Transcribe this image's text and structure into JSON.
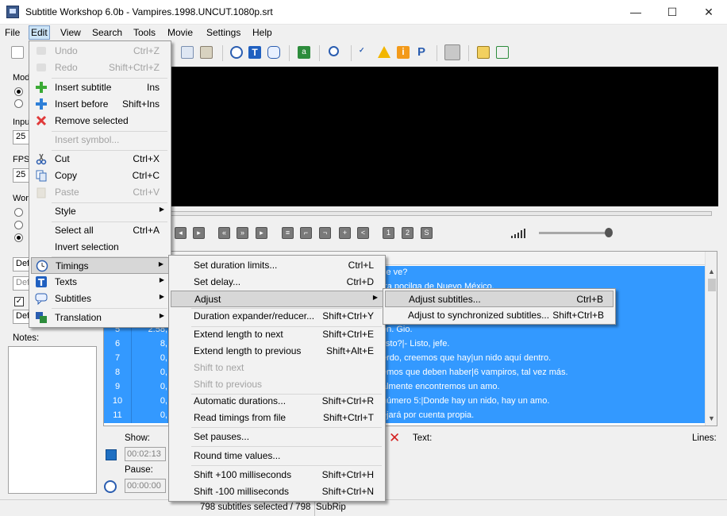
{
  "window": {
    "title": "Subtitle Workshop 6.0b - Vampires.1998.UNCUT.1080p.srt",
    "minimize": "—",
    "maximize": "☐",
    "close": "✕"
  },
  "menubar": [
    "File",
    "Edit",
    "View",
    "Search",
    "Tools",
    "Movie",
    "Settings",
    "Help"
  ],
  "left_panel": {
    "mode_label": "Mod",
    "input_label": "Inpu",
    "input_value": "25",
    "fps_label": "FPS",
    "fps_value": "25",
    "work_label": "Wor",
    "combo1": "Def",
    "combo2": "Def",
    "combo3": "Def",
    "notes_label": "Notes:"
  },
  "subtitle_rows": [
    {
      "num": "",
      "time": "",
      "text": "se ve?"
    },
    {
      "num": "",
      "time": "",
      "text": "tra pocilga de Nuevo México."
    },
    {
      "num": "",
      "time": "",
      "text": ""
    },
    {
      "num": "",
      "time": "",
      "text": ""
    },
    {
      "num": "5",
      "time": "2:58,",
      "text": "en. Gio."
    },
    {
      "num": "6",
      "time": "8,",
      "text": "listo?|- Listo, jefe."
    },
    {
      "num": "7",
      "time": "0,",
      "text": "erdo, creemos que hay|un nido aquí dentro."
    },
    {
      "num": "8",
      "time": "0,",
      "text": "emos que deben haber|6 vampiros, tal vez más."
    },
    {
      "num": "9",
      "time": "0,",
      "text": "almente encontremos un amo."
    },
    {
      "num": "10",
      "time": "0,",
      "text": "número 5:|Donde hay un nido, hay un amo."
    },
    {
      "num": "11",
      "time": "0,",
      "text": "ejará por cuenta propia."
    }
  ],
  "editor": {
    "show_label": "Show:",
    "show_value": "00:02:13",
    "pause_label": "Pause:",
    "pause_value": "00:00:00",
    "text_label": "Text:",
    "lines_label": "Lines:"
  },
  "status": "798 subtitles selected / 798",
  "status_format": "SubRip",
  "edit_menu": [
    {
      "label": "Undo",
      "shortcut": "Ctrl+Z",
      "disabled": true,
      "icon": "undo-icon"
    },
    {
      "label": "Redo",
      "shortcut": "Shift+Ctrl+Z",
      "disabled": true,
      "icon": "redo-icon"
    },
    {
      "label": "Insert subtitle",
      "shortcut": "Ins",
      "disabled": false,
      "icon": "plus-icon"
    },
    {
      "label": "Insert before",
      "shortcut": "Shift+Ins",
      "disabled": false,
      "icon": "plus-blue-icon"
    },
    {
      "label": "Remove selected",
      "shortcut": "",
      "disabled": false,
      "icon": "remove-icon"
    },
    {
      "label": "Insert symbol...",
      "shortcut": "",
      "disabled": true,
      "icon": ""
    },
    {
      "label": "Cut",
      "shortcut": "Ctrl+X",
      "disabled": false,
      "icon": "scissors-icon"
    },
    {
      "label": "Copy",
      "shortcut": "Ctrl+C",
      "disabled": false,
      "icon": "copy-icon"
    },
    {
      "label": "Paste",
      "shortcut": "Ctrl+V",
      "disabled": true,
      "icon": "paste-icon"
    },
    {
      "label": "Style",
      "shortcut": "",
      "disabled": false,
      "icon": ""
    },
    {
      "label": "Select all",
      "shortcut": "Ctrl+A",
      "disabled": false,
      "icon": ""
    },
    {
      "label": "Invert selection",
      "shortcut": "",
      "disabled": false,
      "icon": ""
    },
    {
      "label": "Timings",
      "shortcut": "",
      "disabled": false,
      "icon": "clock-icon"
    },
    {
      "label": "Texts",
      "shortcut": "",
      "disabled": false,
      "icon": "text-icon"
    },
    {
      "label": "Subtitles",
      "shortcut": "",
      "disabled": false,
      "icon": "speech-bubble-icon"
    },
    {
      "label": "Translation",
      "shortcut": "",
      "disabled": false,
      "icon": "translate-icon"
    }
  ],
  "timings_menu": [
    {
      "label": "Set duration limits...",
      "shortcut": "Ctrl+L",
      "disabled": false
    },
    {
      "label": "Set delay...",
      "shortcut": "Ctrl+D",
      "disabled": false
    },
    {
      "label": "Adjust",
      "shortcut": "",
      "disabled": false
    },
    {
      "label": "Duration expander/reducer...",
      "shortcut": "Shift+Ctrl+Y",
      "disabled": false
    },
    {
      "label": "Extend length to next",
      "shortcut": "Shift+Ctrl+E",
      "disabled": false
    },
    {
      "label": "Extend length to previous",
      "shortcut": "Shift+Alt+E",
      "disabled": false
    },
    {
      "label": "Shift to next",
      "shortcut": "",
      "disabled": true
    },
    {
      "label": "Shift to previous",
      "shortcut": "",
      "disabled": true
    },
    {
      "label": "Automatic durations...",
      "shortcut": "Shift+Ctrl+R",
      "disabled": false
    },
    {
      "label": "Read timings from file",
      "shortcut": "Shift+Ctrl+T",
      "disabled": false
    },
    {
      "label": "Set pauses...",
      "shortcut": "",
      "disabled": false
    },
    {
      "label": "Round time values...",
      "shortcut": "",
      "disabled": false
    },
    {
      "label": "Shift +100 milliseconds",
      "shortcut": "Shift+Ctrl+H",
      "disabled": false
    },
    {
      "label": "Shift -100 milliseconds",
      "shortcut": "Shift+Ctrl+N",
      "disabled": false
    }
  ],
  "adjust_menu": [
    {
      "label": "Adjust subtitles...",
      "shortcut": "Ctrl+B"
    },
    {
      "label": "Adjust to synchronized subtitles...",
      "shortcut": "Shift+Ctrl+B"
    }
  ],
  "colors": {
    "selection": "#3399ff",
    "menu_bg": "#f2f2f2",
    "highlight": "#d7d7d7"
  }
}
